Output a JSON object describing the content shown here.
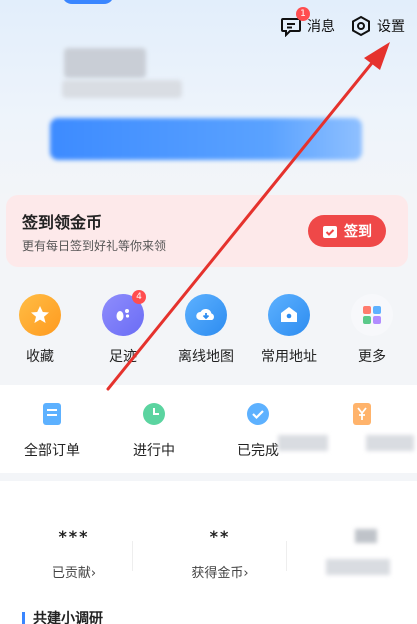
{
  "topbar": {
    "messages_label": "消息",
    "messages_badge": "1",
    "settings_label": "设置"
  },
  "checkin": {
    "title": "签到领金币",
    "subtitle": "更有每日签到好礼等你来领",
    "button_label": "签到"
  },
  "shortcuts": [
    {
      "label": "收藏",
      "icon": "star-icon"
    },
    {
      "label": "足迹",
      "icon": "footprint-icon",
      "badge": "4"
    },
    {
      "label": "离线地图",
      "icon": "cloud-download-icon"
    },
    {
      "label": "常用地址",
      "icon": "home-pin-icon"
    },
    {
      "label": "更多",
      "icon": "grid-icon"
    }
  ],
  "orders": [
    {
      "label": "全部订单",
      "icon": "order-list-icon"
    },
    {
      "label": "进行中",
      "icon": "clock-icon"
    },
    {
      "label": "已完成",
      "icon": "check-icon"
    },
    {
      "label": "",
      "icon": "coupon-icon"
    }
  ],
  "stats": [
    {
      "value": "***",
      "label": "已贡献›"
    },
    {
      "value": "**",
      "label": "获得金币›"
    }
  ],
  "section": {
    "title": "共建小调研"
  },
  "colors": {
    "accent": "#3a86ff",
    "checkin_bg": "#fde9ea",
    "checkin_button": "#ef4848",
    "annotation_arrow": "#e5322d"
  }
}
